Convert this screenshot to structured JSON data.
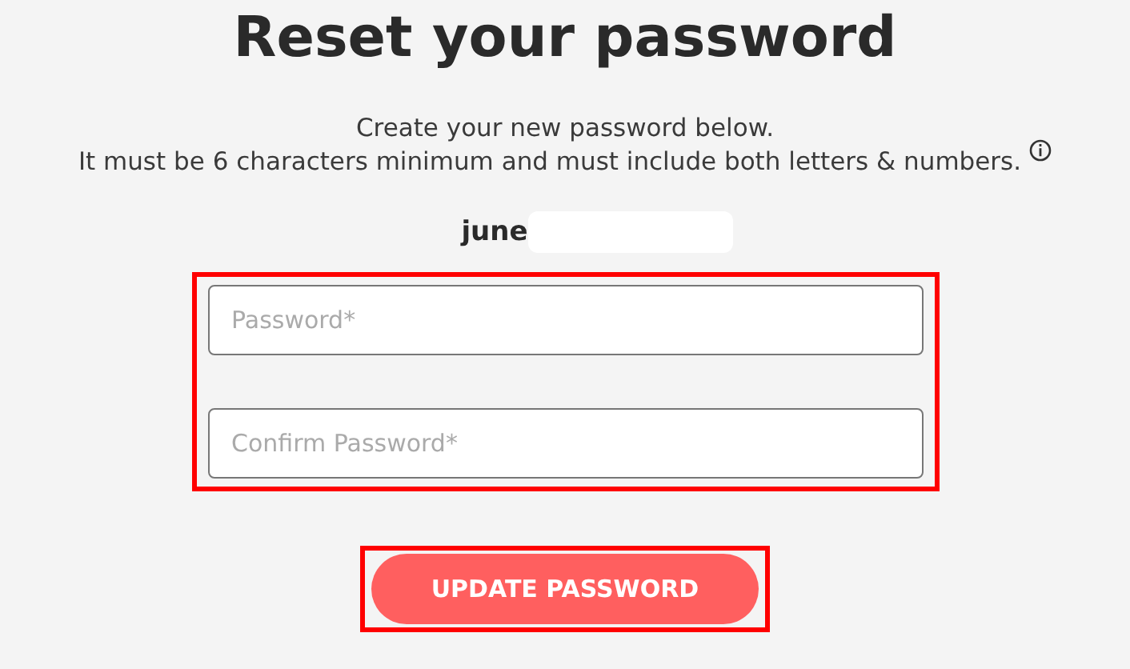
{
  "title": "Reset your password",
  "instructions": [
    "Create your new password below.",
    "It must be 6 characters minimum and must include both letters & numbers."
  ],
  "username": "june",
  "fields": [
    {
      "placeholder": "Password*"
    },
    {
      "placeholder": "Confirm Password*"
    }
  ],
  "button": "UPDATE PASSWORD"
}
